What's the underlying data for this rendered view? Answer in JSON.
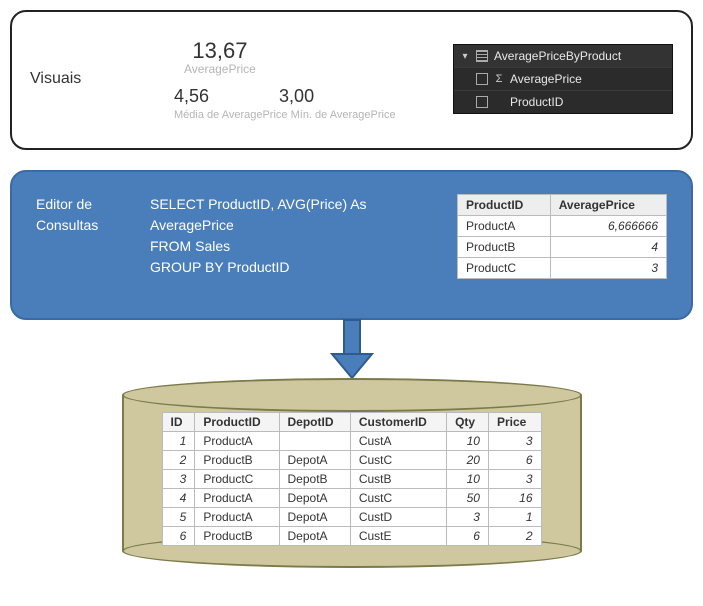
{
  "visuals": {
    "label": "Visuais",
    "metric1_value": "13,67",
    "metric1_label": "AveragePrice",
    "metric2_value": "4,56",
    "metric2_label": "Média de AveragePrice",
    "metric3_value": "3,00",
    "metric3_label": "Mín. de AveragePrice"
  },
  "fields_panel": {
    "table_name": "AveragePriceByProduct",
    "fields": [
      {
        "name": "AveragePrice",
        "is_measure": true
      },
      {
        "name": "ProductID",
        "is_measure": false
      }
    ]
  },
  "query": {
    "label_line1": "Editor de",
    "label_line2": "Consultas",
    "sql_lines": [
      "SELECT ProductID, AVG(Price) As",
      "AveragePrice",
      "FROM Sales",
      "GROUP BY ProductID"
    ],
    "result_headers": [
      "ProductID",
      "AveragePrice"
    ],
    "result_rows": [
      {
        "product": "ProductA",
        "avg": "6,666666"
      },
      {
        "product": "ProductB",
        "avg": "4"
      },
      {
        "product": "ProductC",
        "avg": "3"
      }
    ]
  },
  "source": {
    "headers": [
      "ID",
      "ProductID",
      "DepotID",
      "CustomerID",
      "Qty",
      "Price"
    ],
    "rows": [
      {
        "id": "1",
        "product": "ProductA",
        "depot": "",
        "customer": "CustA",
        "qty": "10",
        "price": "3"
      },
      {
        "id": "2",
        "product": "ProductB",
        "depot": "DepotA",
        "customer": "CustC",
        "qty": "20",
        "price": "6"
      },
      {
        "id": "3",
        "product": "ProductC",
        "depot": "DepotB",
        "customer": "CustB",
        "qty": "10",
        "price": "3"
      },
      {
        "id": "4",
        "product": "ProductA",
        "depot": "DepotA",
        "customer": "CustC",
        "qty": "50",
        "price": "16"
      },
      {
        "id": "5",
        "product": "ProductA",
        "depot": "DepotA",
        "customer": "CustD",
        "qty": "3",
        "price": "1"
      },
      {
        "id": "6",
        "product": "ProductB",
        "depot": "DepotA",
        "customer": "CustE",
        "qty": "6",
        "price": "2"
      }
    ]
  }
}
